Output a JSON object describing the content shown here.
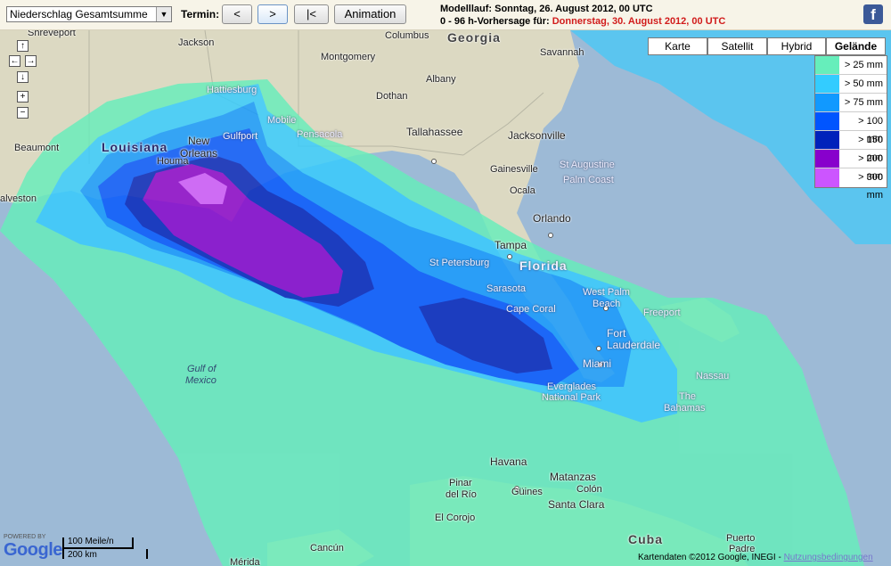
{
  "toolbar": {
    "parameter": "Niederschlag Gesamtsumme",
    "termin_label": "Termin:",
    "prev": "<",
    "next": ">",
    "first": "|<",
    "animation": "Animation"
  },
  "info": {
    "modelllauf": "Modelllauf: Sonntag, 26. August 2012, 00 UTC",
    "forecast_prefix": "0 - 96 h-Vorhersage für: ",
    "forecast_date": "Donnerstag, 30. August 2012, 00 UTC"
  },
  "map_types": [
    "Karte",
    "Satellit",
    "Hybrid",
    "Gelände"
  ],
  "active_map_type": "Gelände",
  "legend": [
    {
      "label": "> 25 mm",
      "color": "#66eebb"
    },
    {
      "label": "> 50 mm",
      "color": "#33ccff"
    },
    {
      "label": "> 75 mm",
      "color": "#1199ff"
    },
    {
      "label": "> 100 mm",
      "color": "#0055ff"
    },
    {
      "label": "> 150 mm",
      "color": "#0022bb"
    },
    {
      "label": "> 200 mm",
      "color": "#8800cc"
    },
    {
      "label": "> 300 mm",
      "color": "#cc55ff"
    }
  ],
  "map_labels": {
    "shreveport": "Shreveport",
    "jackson": "Jackson",
    "columbus": "Columbus",
    "georgia": "Georgia",
    "savannah": "Savannah",
    "montgomery": "Montgomery",
    "albany": "Albany",
    "dothan": "Dothan",
    "hattiesburg": "Hattiesburg",
    "mobile": "Mobile",
    "gulfport": "Gulfport",
    "pensacola": "Pensacola",
    "tallahassee": "Tallahassee",
    "jacksonville": "Jacksonville",
    "beaumont": "Beaumont",
    "louisiana": "Louisiana",
    "new": "New",
    "orleans": "Orleans",
    "houma": "Houma",
    "alveston": "alveston",
    "gainesville": "Gainesville",
    "st_augustine": "St Augustine",
    "ocala": "Ocala",
    "palm_coast": "Palm Coast",
    "orlando": "Orlando",
    "tampa": "Tampa",
    "st_petersburg": "St Petersburg",
    "florida": "Florida",
    "sarasota": "Sarasota",
    "cape_coral": "Cape Coral",
    "west_palm": "West Palm",
    "beach": "Beach",
    "freeport": "Freeport",
    "fort": "Fort",
    "lauderdale": "Lauderdale",
    "miami": "Miami",
    "nassau": "Nassau",
    "gulf_of": "Gulf of",
    "mexico": "Mexico",
    "everglades": "Everglades",
    "national_park": "National Park",
    "the": "The",
    "bahamas": "Bahamas",
    "havana": "Havana",
    "matanzas": "Matanzas",
    "pinar": "Pinar",
    "del_rio": "del Río",
    "guines": "Güines",
    "colon": "Colón",
    "santa_clara": "Santa Clara",
    "el_corojo": "El Corojo",
    "cuba": "Cuba",
    "puerto": "Puerto",
    "padre": "Padre",
    "cancun": "Cancún",
    "merida": "Mérida"
  },
  "map_controls": {
    "up": "↑",
    "left": "←",
    "right": "→",
    "down": "↓",
    "zoom_in": "+",
    "zoom_out": "−"
  },
  "branding": {
    "powered_by": "POWERED BY",
    "google": "Google",
    "scale_imperial": "100 Meile/n",
    "scale_metric": "200 km",
    "copyright": "Kartendaten ©2012 Google, INEGI - ",
    "terms": "Nutzungsbedingungen"
  },
  "facebook_icon": "f"
}
